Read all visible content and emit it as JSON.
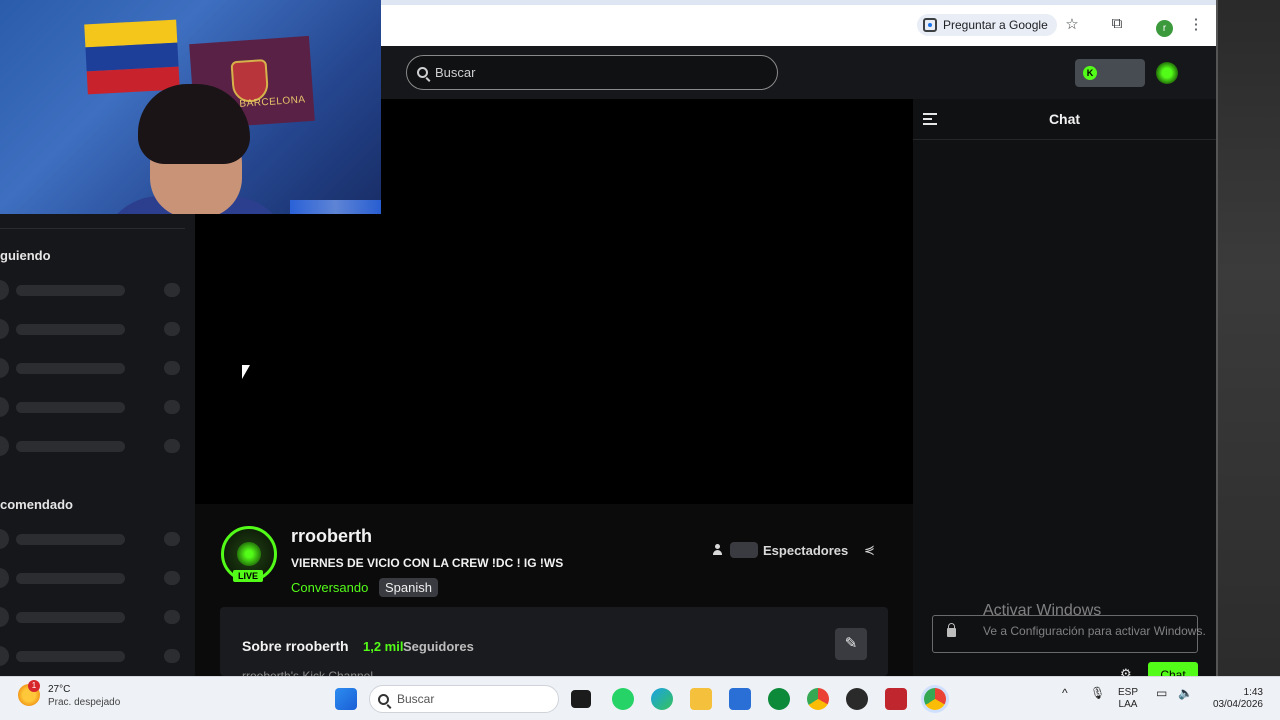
{
  "browser": {
    "ask_google_label": "Preguntar a Google",
    "profile_initial": "r"
  },
  "header": {
    "search_placeholder": "Buscar"
  },
  "sidebar": {
    "following_title": "guiendo",
    "recommended_title": "comendado"
  },
  "channel": {
    "name": "rrooberth",
    "live_badge": "LIVE",
    "stream_title": "VIERNES DE VICIO CON LA CREW !DC ! IG !WS",
    "category": "Conversando",
    "language": "Spanish",
    "viewers_label": "Espectadores"
  },
  "about": {
    "title": "Sobre rrooberth",
    "followers_count": "1,2 mil",
    "followers_label": "Seguidores",
    "description": "rrooberth's Kick Channel"
  },
  "chat": {
    "title": "Chat",
    "send_label": "Chat"
  },
  "webcam": {
    "flag_text": "BARCELONA"
  },
  "watermark": {
    "line1": "Activar Windows",
    "line2": "Ve a Configuración para activar Windows."
  },
  "taskbar": {
    "temperature": "27°C",
    "condition": "Prac. despejado",
    "weather_badge": "1",
    "search_placeholder": "Buscar",
    "language_line1": "ESP",
    "language_line2": "LAA",
    "time": "1:43",
    "date": "03/04/2026"
  },
  "colors": {
    "kick_green": "#53fc18",
    "background": "#0b0b0c",
    "panel": "#16171a"
  }
}
